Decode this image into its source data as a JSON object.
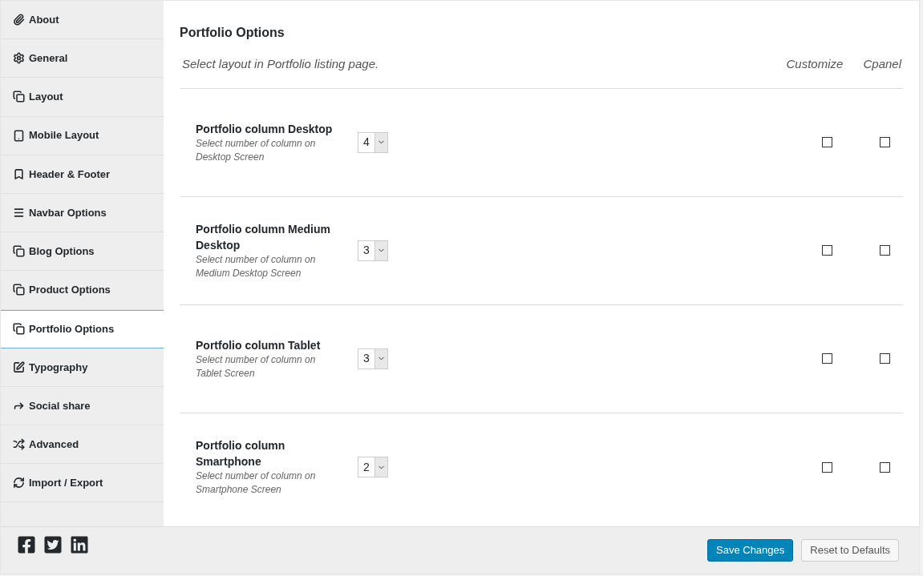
{
  "sidebar": {
    "items": [
      {
        "label": "About",
        "selected": false
      },
      {
        "label": "General",
        "selected": false
      },
      {
        "label": "Layout",
        "selected": false
      },
      {
        "label": "Mobile Layout",
        "selected": false
      },
      {
        "label": "Header & Footer",
        "selected": false
      },
      {
        "label": "Navbar Options",
        "selected": false
      },
      {
        "label": "Blog Options",
        "selected": false
      },
      {
        "label": "Product Options",
        "selected": false
      },
      {
        "label": "Portfolio Options",
        "selected": true
      },
      {
        "label": "Typography",
        "selected": false
      },
      {
        "label": "Social share",
        "selected": false
      },
      {
        "label": "Advanced",
        "selected": false
      },
      {
        "label": "Import / Export",
        "selected": false
      }
    ]
  },
  "section": {
    "title": "Portfolio Options",
    "description": "Select layout in Portfolio listing page.",
    "columns": [
      "Customize",
      "Cpanel"
    ]
  },
  "options": [
    {
      "title": "Portfolio column Desktop",
      "description": "Select number of column on Desktop Screen",
      "value": "4",
      "customize": false,
      "cpanel": false
    },
    {
      "title": "Portfolio column Medium Desktop",
      "description": "Select number of column on Medium Desktop Screen",
      "value": "3",
      "customize": false,
      "cpanel": false
    },
    {
      "title": "Portfolio column Tablet",
      "description": "Select number of column on Tablet Screen",
      "value": "3",
      "customize": false,
      "cpanel": false
    },
    {
      "title": "Portfolio column Smartphone",
      "description": "Select number of column on Smartphone Screen",
      "value": "2",
      "customize": false,
      "cpanel": false
    }
  ],
  "footer": {
    "buttons": [
      "Save Changes",
      "Reset to Defaults"
    ]
  }
}
